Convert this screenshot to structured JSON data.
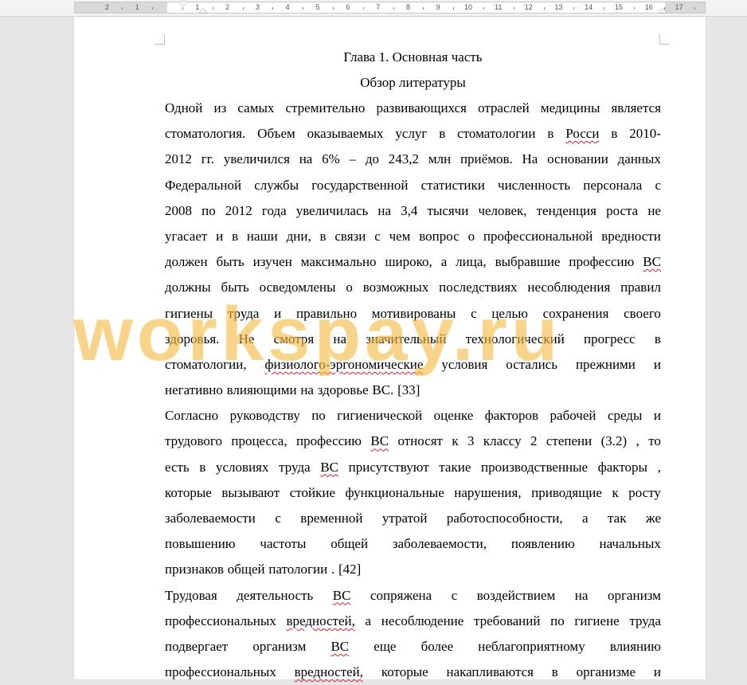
{
  "ruler": {
    "numbers": [
      "2",
      "1",
      "1",
      "2",
      "3",
      "4",
      "5",
      "6",
      "7",
      "8",
      "9",
      "10",
      "11",
      "12",
      "13",
      "14",
      "15",
      "16",
      "17"
    ]
  },
  "document": {
    "chapter_title": "Глава 1. Основная часть",
    "section_title": "Обзор литературы",
    "paragraphs": [
      {
        "lines": [
          [
            "Одной",
            "из",
            "самых",
            "стремительно",
            "развивающихся",
            "отраслей",
            "медицины",
            "является"
          ],
          [
            "стоматология.",
            "Объем",
            "оказываемых",
            "услуг",
            "в",
            "стоматологии",
            "в",
            "Росси",
            "в",
            "2010-"
          ],
          [
            "2012",
            "гг.",
            "увеличился",
            "на",
            "6%",
            "–",
            "до",
            "243,2",
            "млн",
            "приёмов.",
            "На",
            "основании",
            "данных"
          ],
          [
            "Федеральной",
            "службы",
            "государственной",
            "статистики",
            "численность",
            "персонала",
            "с"
          ],
          [
            "2008",
            "по",
            "2012",
            "года",
            "увеличилась",
            "на",
            "3,4",
            "тысячи",
            "человек,",
            "тенденция",
            "роста",
            "не"
          ],
          [
            "угасает",
            "и",
            "в",
            "наши",
            "дни,",
            "в",
            "связи",
            "с",
            "чем",
            "вопрос",
            "о",
            "профессиональной",
            "вредности"
          ],
          [
            "должен",
            "быть",
            "изучен",
            "максимально",
            "широко,",
            "а",
            "лица,",
            "выбравшие",
            "профессию",
            "ВС"
          ],
          [
            "должны",
            "быть",
            "осведомлены",
            "о",
            "возможных",
            "последствиях",
            "несоблюдения",
            "правил"
          ],
          [
            "гигиены",
            "труда",
            "и",
            "правильно",
            "мотивированы",
            "с",
            "целью",
            "сохранения",
            "своего"
          ],
          [
            "здоровья.",
            "Не",
            "смотря",
            "на",
            "значительный",
            "технологический",
            "прогресс",
            "в"
          ],
          [
            "стоматологии,",
            "физиолого-эргономические",
            "условия",
            "остались",
            "прежними",
            "и"
          ],
          [
            "негативно",
            "влияющими",
            "на",
            "здоровье",
            "ВС.",
            "[33]"
          ]
        ]
      },
      {
        "lines": [
          [
            "Согласно",
            "руководству",
            "по",
            "гигиенической",
            "оценке",
            "факторов",
            "рабочей",
            "среды",
            "и"
          ],
          [
            "трудового",
            "процесса,",
            "профессию",
            "ВС",
            "относят",
            "к",
            "3",
            "классу",
            "2",
            "степени",
            "(3.2)",
            ",",
            "то"
          ],
          [
            "есть",
            "в",
            "условиях",
            "труда",
            "ВС",
            "присутствуют",
            "такие",
            "производственные",
            "факторы",
            ","
          ],
          [
            "которые",
            "вызывают",
            "стойкие",
            "функциональные",
            "нарушения,",
            "приводящие",
            "к",
            "росту"
          ],
          [
            "заболеваемости",
            "с",
            "временной",
            "утратой",
            "работоспособности,",
            "а",
            "так",
            "же"
          ],
          [
            "повышению",
            "частоты",
            "общей",
            "заболеваемости,",
            "появлению",
            "начальных"
          ],
          [
            "признаков",
            "общей",
            "патологии",
            ".",
            "[42]"
          ]
        ]
      },
      {
        "lines": [
          [
            "Трудовая",
            "деятельность",
            "ВС",
            "сопряжена",
            "с",
            "воздействием",
            "на",
            "организм"
          ],
          [
            "профессиональных",
            "вредностей,",
            "а",
            "несоблюдение",
            "требований",
            "по",
            "гигиене",
            "труда"
          ],
          [
            "подвергает",
            "организм",
            "ВС",
            "еще",
            "более",
            "неблагоприятному",
            "влиянию"
          ],
          [
            "профессиональных",
            "вредностей,",
            "которые",
            "накапливаются",
            "в",
            "организме",
            "и"
          ]
        ]
      }
    ],
    "spellcheck_words": [
      "Росси",
      "ВС",
      "физиолого-эргономические",
      "вредностей,"
    ]
  },
  "watermark": {
    "text": "workspay.ru",
    "color": "#ECAA28"
  }
}
